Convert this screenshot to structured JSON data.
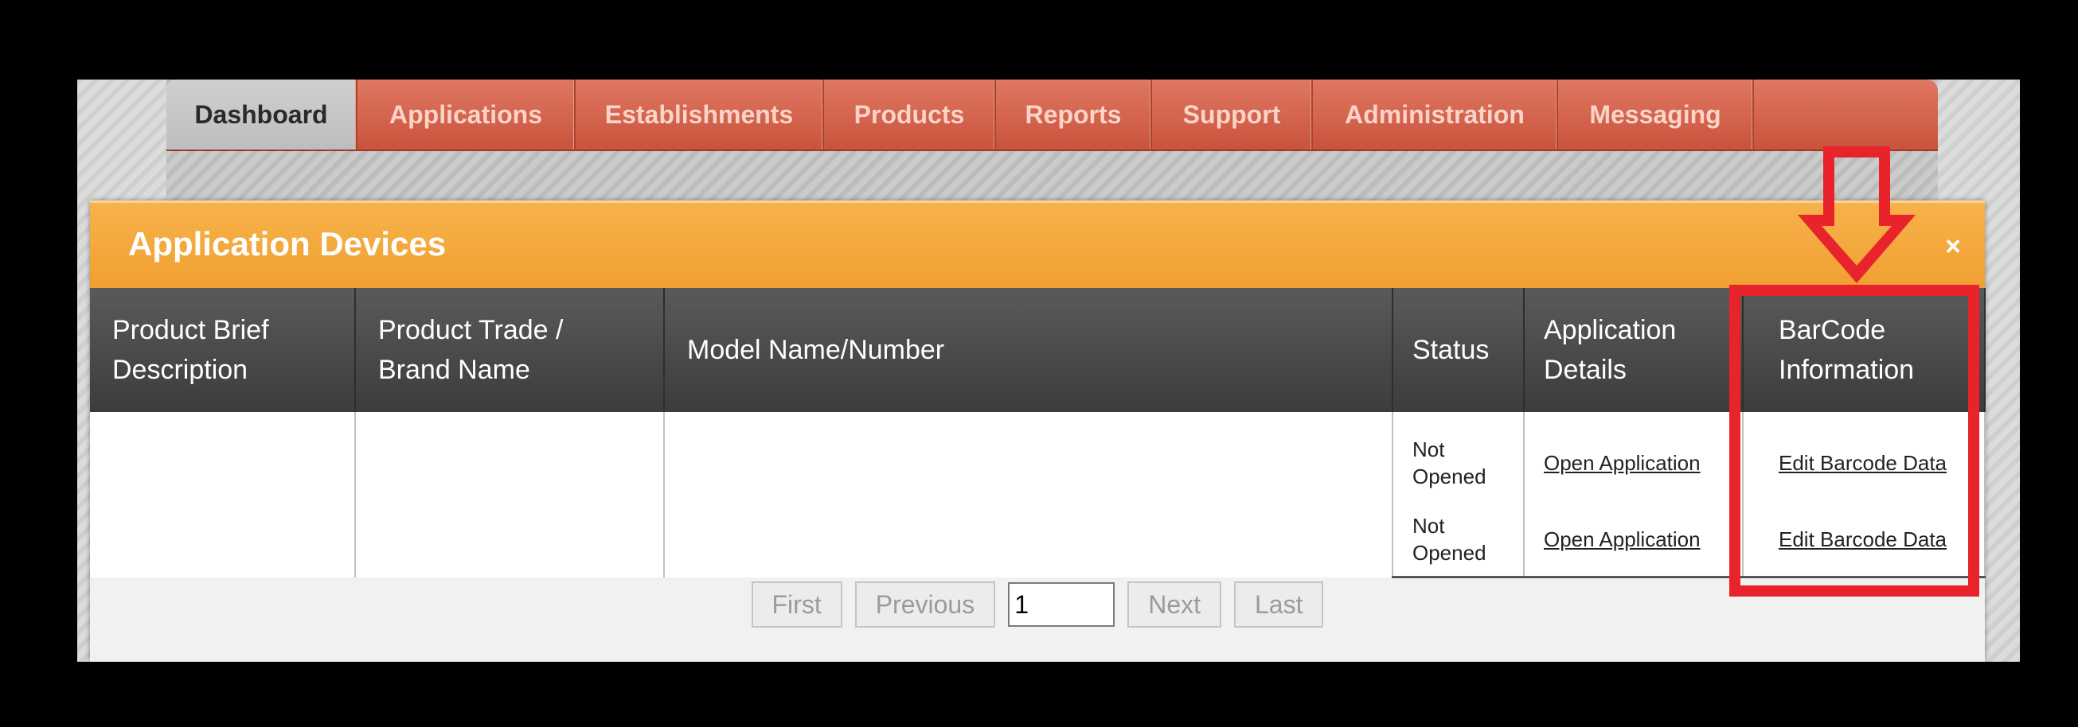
{
  "nav": {
    "tabs": [
      {
        "label": "Dashboard",
        "active": true
      },
      {
        "label": "Applications"
      },
      {
        "label": "Establishments"
      },
      {
        "label": "Products"
      },
      {
        "label": "Reports"
      },
      {
        "label": "Support"
      },
      {
        "label": "Administration"
      },
      {
        "label": "Messaging"
      }
    ]
  },
  "modal": {
    "title": "Application Devices",
    "close": "×",
    "columns": [
      "Product Brief Description",
      "Product Trade / Brand Name",
      "Model Name/Number",
      "Status",
      "Application Details",
      "BarCode Information"
    ],
    "rows": [
      {
        "brief": "",
        "brand": "",
        "model": "",
        "status": "Not Opened",
        "details_link": "Open Application",
        "barcode_link": "Edit Barcode Data"
      },
      {
        "brief": "",
        "brand": "",
        "model": "",
        "status": "Not Opened",
        "details_link": "Open Application",
        "barcode_link": "Edit Barcode Data"
      }
    ],
    "pager": {
      "first": "First",
      "previous": "Previous",
      "page": "1",
      "next": "Next",
      "last": "Last"
    }
  },
  "colors": {
    "header_orange": "#f5a93b",
    "tab_red": "#d4604a",
    "highlight_red": "#e8232c"
  }
}
